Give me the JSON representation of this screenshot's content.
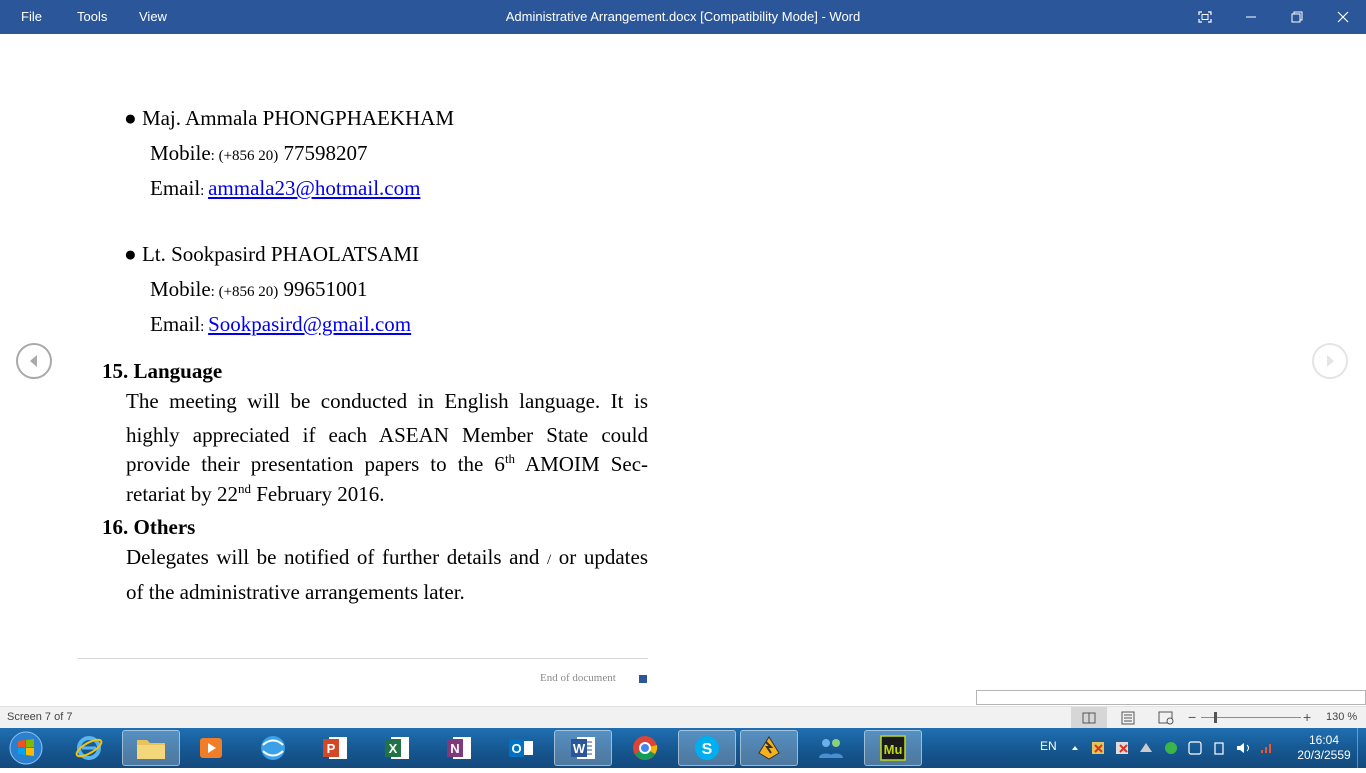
{
  "window": {
    "title": "Administrative Arrangement.docx [Compatibility Mode] - Word",
    "menu": [
      "File",
      "Tools",
      "View"
    ]
  },
  "document": {
    "contacts": [
      {
        "name": "Maj. Ammala PHONGPHAEKHAM",
        "mobile_label": "Mobile",
        "mobile_prefix": "(+856 20)",
        "mobile_number": "77598207",
        "email_label": "Email",
        "email": "ammala23@hotmail.com"
      },
      {
        "name": "Lt. Sookpasird PHAOLATSAMI",
        "mobile_label": "Mobile",
        "mobile_prefix": "(+856 20)",
        "mobile_number": "99651001",
        "email_label": "Email",
        "email": "Sookpasird@gmail.com"
      }
    ],
    "section15": {
      "heading": "15. Language",
      "line1": "The meeting will be conducted in English language. It is",
      "line2": "highly appreciated if each ASEAN Member State could",
      "line3_pre": "provide their presentation papers to the 6",
      "line3_sup": "th",
      "line3_post": " AMOIM Sec-",
      "line4_pre": "retariat by 22",
      "line4_sup": "nd",
      "line4_post": " February 2016."
    },
    "section16": {
      "heading": "16. Others",
      "line1_pre": "Delegates will be notified of further details and ",
      "line1_slash": "/",
      "line1_post": " or updates",
      "line2": "of the administrative arrangements later."
    },
    "end_text": "End of document"
  },
  "statusbar": {
    "screen": "Screen 7 of 7",
    "zoom": "130 %"
  },
  "taskbar": {
    "apps": [
      "start",
      "internet-explorer",
      "file-explorer",
      "media-player",
      "browser-globe",
      "powerpoint",
      "excel",
      "onenote",
      "outlook",
      "word",
      "chrome",
      "skype",
      "winamp",
      "network-users",
      "muse"
    ],
    "active_app": "word",
    "tray": {
      "language": "EN",
      "time": "16:04",
      "date": "20/3/2559"
    }
  }
}
